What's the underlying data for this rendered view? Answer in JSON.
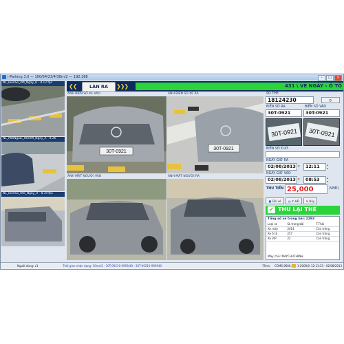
{
  "window": {
    "title": "i-Parking 3.0 — 100/64/23/4/38m/2 — 192.168"
  },
  "cameras": [
    {
      "label": "N1_BienSo_XM_Ngay_R - 8.12 fps"
    },
    {
      "label": "N1_MatNguoi_OtoXM_Ngay_R - 8.26"
    },
    {
      "label": "N1_BienSo_Oto_Ngay_R - 8.39 fps"
    }
  ],
  "topbar": {
    "chevrons_left": "❮❮",
    "chevrons_right": "❯❯❯",
    "direction": "LÀN RA",
    "ticket_title": "431 \\ VÉ NGÀY - Ô TÔ"
  },
  "images": {
    "plate_in": "ẢNH BIỂN SỐ XE VÀO",
    "plate_out": "ẢNH BIỂN SỐ XE RA",
    "face_in": "ẢNH MẶT NGƯỜI VÀO",
    "face_out": "ẢNH MẶT NGƯỜI RA",
    "plate_text": "30T-0921"
  },
  "panel": {
    "card_label": "SỐ THẺ",
    "card_number": "18124230",
    "plate_out_label": "BIỂN SỐ RA",
    "plate_in_label": "BIỂN SỐ VÀO",
    "plate_out": "30T-0921",
    "plate_in": "30T-0921",
    "plate_reg_label": "BIỂN SỐ Đ.KÝ",
    "time_out_label": "NGÀY GIỜ RA",
    "date_out": "02/08/2013",
    "time_out": "12:11",
    "time_in_label": "NGÀY GIỜ VÀO",
    "date_in": "02/08/2013",
    "time_in": "08:53",
    "fee_label": "THU TIỀN",
    "fee": "25,000",
    "currency": "(VNĐ)",
    "btn_save": "Ghi vé",
    "btn_print": "In HĐ",
    "btn_cancel": "Hủy",
    "thu_lai": "THU LẠI THẺ",
    "total_label": "Tổng số xe trong bãi: 2293",
    "table_headers": [
      "Loại xe",
      "SL trong bãi",
      "T.Thái"
    ],
    "table_rows": [
      [
        "Xe máy",
        "2014",
        "Còn trống"
      ],
      [
        "Xe ô tô",
        "257",
        "Còn trống"
      ],
      [
        "Xe VIP",
        "22",
        "Còn trống"
      ]
    ],
    "pc_label": "Máy chủ: MAYCHUCHINH"
  },
  "status": {
    "user": "Người dùng: c1",
    "log": "Thời gian nhận dạng: 30ms/2 - 30T-09210-9999/40 - 30T-09210-999940",
    "latency": "75ms",
    "port": "COM5,9600,1",
    "counter": "1-2000/0",
    "clock": "12:11:33 - 02/08/2013"
  },
  "colors": {
    "accent_navy": "#0d2b5c",
    "accent_green": "#2ad43a",
    "fee_red": "#e01e1e"
  }
}
